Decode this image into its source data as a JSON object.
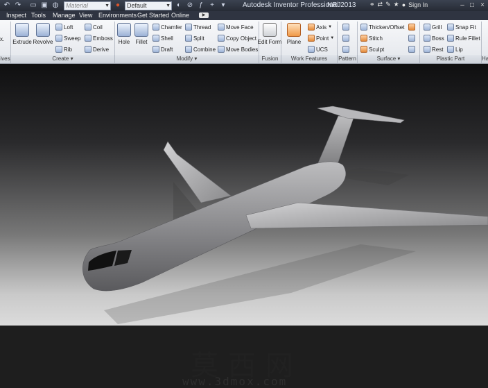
{
  "title_bar": {
    "material_placeholder": "Material",
    "appearance_value": "Default",
    "app_title": "Autodesk Inventor Professional 2013",
    "file_name": "NRJ",
    "sign_in": "Sign In"
  },
  "menu": {
    "tabs": [
      "Inspect",
      "Tools",
      "Manage",
      "View",
      "Environments",
      "Get Started",
      "Online"
    ]
  },
  "ribbon": {
    "panels": {
      "left_cut": "ives",
      "create": "Create",
      "modify": "Modify",
      "fusion": "Fusion",
      "work_features": "Work Features",
      "pattern": "Pattern",
      "surface": "Surface",
      "plastic_part": "Plastic Part",
      "right_cut": "Ha"
    },
    "create": {
      "extrude": "Extrude",
      "revolve": "Revolve",
      "loft": "Loft",
      "sweep": "Sweep",
      "rib": "Rib",
      "coil": "Coil",
      "emboss": "Emboss",
      "derive": "Derive"
    },
    "modify": {
      "hole": "Hole",
      "fillet": "Fillet",
      "chamfer": "Chamfer",
      "shell": "Shell",
      "draft": "Draft",
      "thread": "Thread",
      "split": "Split",
      "combine": "Combine",
      "move_face": "Move Face",
      "copy_object": "Copy Object",
      "move_bodies": "Move Bodies"
    },
    "fusion": {
      "edit_form": "Edit Form"
    },
    "work_features": {
      "plane": "Plane",
      "axis": "Axis",
      "point": "Point",
      "ucs": "UCS"
    },
    "surface": {
      "thicken": "Thicken/Offset",
      "stitch": "Stitch",
      "sculpt": "Sculpt"
    },
    "plastic": {
      "grill": "Grill",
      "boss": "Boss",
      "rest": "Rest",
      "snap_fit": "Snap Fit",
      "rule_fillet": "Rule Fillet",
      "lip": "Lip"
    }
  },
  "watermark": {
    "chars": "莫西网",
    "url": "www.3dmox.com"
  },
  "colors": {
    "title_bg": "#2f3441",
    "ribbon_bg": "#e8ebf0",
    "model_gray": "#8e8e90"
  }
}
